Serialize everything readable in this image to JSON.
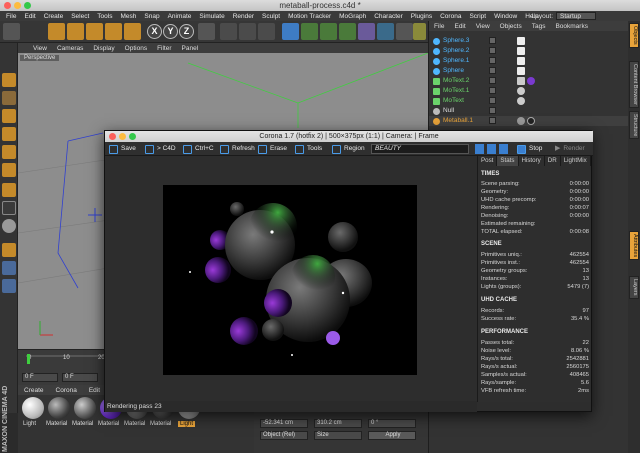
{
  "window": {
    "title": "metaball-process.c4d *"
  },
  "menubar": [
    "File",
    "Edit",
    "Create",
    "Select",
    "Tools",
    "Mesh",
    "Snap",
    "Animate",
    "Simulate",
    "Render",
    "Sculpt",
    "Motion Tracker",
    "MoGraph",
    "Character",
    "Plugins",
    "Corona",
    "Script",
    "Window",
    "Help"
  ],
  "layout": {
    "label": "Layout:",
    "value": "Startup"
  },
  "toolbar": {
    "axes": [
      "X",
      "Y",
      "Z"
    ]
  },
  "viewport": {
    "menu": [
      "View",
      "Cameras",
      "Display",
      "Options",
      "Filter",
      "Panel"
    ],
    "label": "Perspective"
  },
  "timeline": {
    "ticks": [
      "0",
      "10",
      "20"
    ],
    "frame_start": "0 F",
    "frame_field": "0 F"
  },
  "materials": {
    "menu": [
      "Create",
      "Corona",
      "Edit"
    ],
    "items": [
      "Light",
      "Material",
      "Material",
      "Material",
      "Material",
      "Material",
      "Light"
    ]
  },
  "attributes": {
    "fields": [
      "-52.341 cm",
      "310.2 cm",
      "0 °"
    ],
    "dropdown1": "Object (Rel)",
    "dropdown2": "Size",
    "apply": "Apply"
  },
  "objects": {
    "menu": [
      "File",
      "Edit",
      "View",
      "Objects",
      "Tags",
      "Bookmarks"
    ],
    "rows": [
      {
        "name": "Sphere.3",
        "color": "#4fb7ff"
      },
      {
        "name": "Sphere.2",
        "color": "#4fb7ff"
      },
      {
        "name": "Sphere.1",
        "color": "#4fb7ff"
      },
      {
        "name": "Sphere",
        "color": "#4fb7ff"
      },
      {
        "name": "MoText.2",
        "color": "#6bd36b"
      },
      {
        "name": "MoText.1",
        "color": "#6bd36b"
      },
      {
        "name": "MoText",
        "color": "#6bd36b"
      },
      {
        "name": "Null",
        "color": "#bbbbbb"
      },
      {
        "name": "Metaball.1",
        "color": "#e8a33a"
      }
    ]
  },
  "right_tabs": [
    "Objects",
    "Content Browser",
    "Structure",
    "Attributes",
    "Layers"
  ],
  "corona": {
    "title": "Corona 1.7 (hotfix 2) | 500×375px (1:1) | Camera: | Frame",
    "toolbar": [
      "Save",
      "> C4D",
      "Ctrl+C",
      "Refresh",
      "Erase",
      "Tools",
      "Region"
    ],
    "pass": "BEAUTY",
    "stop": "Stop",
    "render": "Render",
    "status": "Rendering pass 23",
    "tabs": [
      "Post",
      "Stats",
      "History",
      "DR",
      "LightMix"
    ],
    "sections": [
      {
        "title": "TIMES",
        "rows": [
          [
            "Scene parsing:",
            "0:00:00"
          ],
          [
            "Geometry:",
            "0:00:00"
          ],
          [
            "UHD cache precomp:",
            "0:00:00"
          ],
          [
            "Rendering:",
            "0:00:07"
          ],
          [
            "Denoising:",
            "0:00:00"
          ],
          [
            "Estimated remaining:",
            ""
          ],
          [
            "TOTAL elapsed:",
            "0:00:08"
          ]
        ]
      },
      {
        "title": "SCENE",
        "rows": [
          [
            "Primitives uniq.:",
            "462554"
          ],
          [
            "Primitives inst.:",
            "462554"
          ],
          [
            "Geometry groups:",
            "13"
          ],
          [
            "Instances:",
            "13"
          ],
          [
            "Lights (groups):",
            "5479 (7)"
          ]
        ]
      },
      {
        "title": "UHD CACHE",
        "rows": [
          [
            "Records:",
            "97"
          ],
          [
            "Success rate:",
            "35.4 %"
          ]
        ]
      },
      {
        "title": "PERFORMANCE",
        "rows": [
          [
            "Passes total:",
            "22"
          ],
          [
            "Noise level:",
            "8.06 %"
          ],
          [
            "Rays/s total:",
            "2542881"
          ],
          [
            "Rays/s actual:",
            "2560175"
          ],
          [
            "Samples/s actual:",
            "408465"
          ],
          [
            "Rays/sample:",
            "5.6"
          ],
          [
            "VFB refresh time:",
            "2ms"
          ]
        ]
      }
    ]
  },
  "brand": {
    "line1": "MAXON",
    "line2": "CINEMA 4D"
  }
}
